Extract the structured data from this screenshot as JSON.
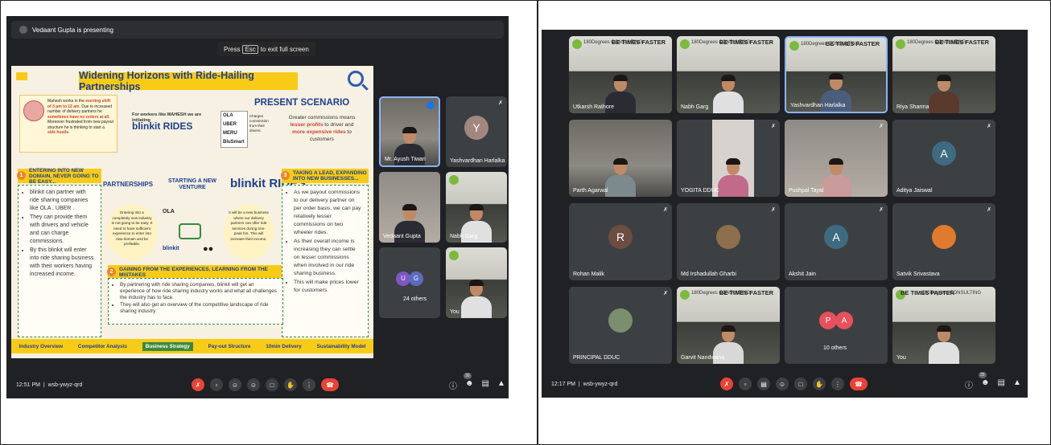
{
  "left": {
    "presenting_text": "Vedaant Gupta is presenting",
    "esc_hint": {
      "pre": "Press",
      "key": "Esc",
      "post": "to exit full screen"
    },
    "slide": {
      "title": "Widening Horizons with Ride-Hailing Partnerships",
      "story": {
        "pre": "Mahesh works in the ",
        "emph1": "evening shift of 3 pm to 12 am",
        "mid": ". Due to increased number of delivery partners he ",
        "emph2": "sometimes have no orders at all.",
        "post": " Moreover frustrated from new payout structure he is thinking to start a ",
        "emph3": "side hustle."
      },
      "workers_text": "For workers like MAHESH we are initiating",
      "blinkit_rides": "blinkit RIDES",
      "present_scenario": "PRESENT SCENARIO",
      "cab_logos": [
        "OLA",
        "UBER",
        "MERU",
        "BluSmart"
      ],
      "charges": "Charges commission from their drivers.",
      "greater": {
        "a": "Greater commissions means ",
        "b": "lesser profits",
        "c": " to driver and ",
        "d": "more expensive rides",
        "e": " to customers"
      },
      "sec1_head": "ENTERING INTO NEW DOMAIN, NEVER GOING TO BE EASY...",
      "sec1_items": [
        "blinkit can partner with ride sharing companies like OLA , UBER .",
        "They can provide them with drivers and vehicle and can charge commissions.",
        "By this blinkit will enter into ride sharing business with their workers having increased income."
      ],
      "partnerships": "PARTNERSHIPS",
      "start_venture": "STARTING A NEW VENTURE",
      "blinkit_big": "blinkit RIDES",
      "enter_blob": "Entering into a completely new industry is not going to be easy. It need to have sufficient experience to enter into new domain and be profitable.",
      "new_blob": "It will be a new business where our delivery partners can offer ride services during non-peak hrs. This will increase their income.",
      "flow_ola": "OLA",
      "flow_blinkit": "blinkit",
      "sec3_head": "TAKING A LEAD, EXPANDING INTO NEW BUSINESSES...",
      "sec3_items": [
        "As we payout commissions to our delivery partner on per order basis, we can pay relatively lesser commissions on two wheeler rides.",
        "As their overall income is increasing they can settle on lesser commissions when involved in our ride sharing business.",
        "This will make prices lower for customers."
      ],
      "gain_head": "GAINING FROM THE EXPERIENCES, LEARNING FROM THE MISTAKES",
      "gain_items": [
        "By partnering with ride sharing companies, blinkit will get an experience of how ride sharing industry works and what all challenges the industry has to face.",
        "They will also get an overview of the competitive landscape of ride sharing industry"
      ],
      "nav": [
        "Industry Overview",
        "Competitor Analysis",
        "Business Strategy",
        "Pay-out Structure",
        "10min Delivery",
        "Sustainability Model"
      ],
      "nav_active": "Business Strategy"
    },
    "tiles": [
      {
        "name": "Mr. Ayush Tiwari",
        "type": "video"
      },
      {
        "name": "Yashvardhan Harlalka",
        "type": "avatar",
        "letter": "Y",
        "color": "#a1887f"
      },
      {
        "name": "Vedaant Gupta",
        "type": "video"
      },
      {
        "name": "Nabh Garg",
        "type": "banner"
      },
      {
        "name": "24 others",
        "type": "others",
        "letters": [
          "U",
          "G"
        ]
      },
      {
        "name": "You",
        "type": "banner"
      }
    ],
    "clock": "12:51 PM",
    "meeting_code": "wsb-ywyz-qrd",
    "people_count": "30"
  },
  "right": {
    "banner_brand": "180Degrees CONSULTING",
    "banner_slogan": "BE TIMES FASTER",
    "tiles": [
      {
        "name": "Utkarsh Rathore",
        "type": "banner"
      },
      {
        "name": "Nabh Garg",
        "type": "banner"
      },
      {
        "name": "Yashvardhan Harlalka",
        "type": "banner"
      },
      {
        "name": "Riya Sharma",
        "type": "banner"
      },
      {
        "name": "Parth Agarwal",
        "type": "video"
      },
      {
        "name": "YOGITA DDUC",
        "type": "video"
      },
      {
        "name": "Pushpal Tayal",
        "type": "video"
      },
      {
        "name": "Aditya Jaiswal",
        "type": "avatar",
        "letter": "A",
        "color": "#3f6b80"
      },
      {
        "name": "Rohan Malik",
        "type": "avatar",
        "letter": "R",
        "color": "#6d4c41"
      },
      {
        "name": "Md Irshadullah Gharbi",
        "type": "photo"
      },
      {
        "name": "Akshit Jain",
        "type": "avatar",
        "letter": "A",
        "color": "#3f6b80"
      },
      {
        "name": "Satvik Srivastava",
        "type": "photo"
      },
      {
        "name": "PRINCIPAL DDUC",
        "type": "photo"
      },
      {
        "name": "Garvit Nandwana",
        "type": "banner"
      },
      {
        "name": "10 others",
        "type": "others",
        "letters": [
          "P",
          "A"
        ]
      },
      {
        "name": "You",
        "type": "banner"
      }
    ],
    "clock": "12:17 PM",
    "meeting_code": "wsb-ywyz-qrd",
    "people_count": "25"
  },
  "icons": {
    "controls": [
      "mic-off-icon",
      "captions-icon",
      "emoji-icon",
      "present-icon",
      "raise-hand-icon",
      "more-icon",
      "hangup-icon"
    ],
    "right_controls": [
      "info-icon",
      "people-icon",
      "chat-icon",
      "activities-icon"
    ]
  },
  "colors": {
    "meet_bg": "#202124",
    "tile_bg": "#3c4043",
    "slide_yellow": "#f8cb16",
    "slide_blue": "#1d3f8f",
    "red": "#ea4335"
  }
}
